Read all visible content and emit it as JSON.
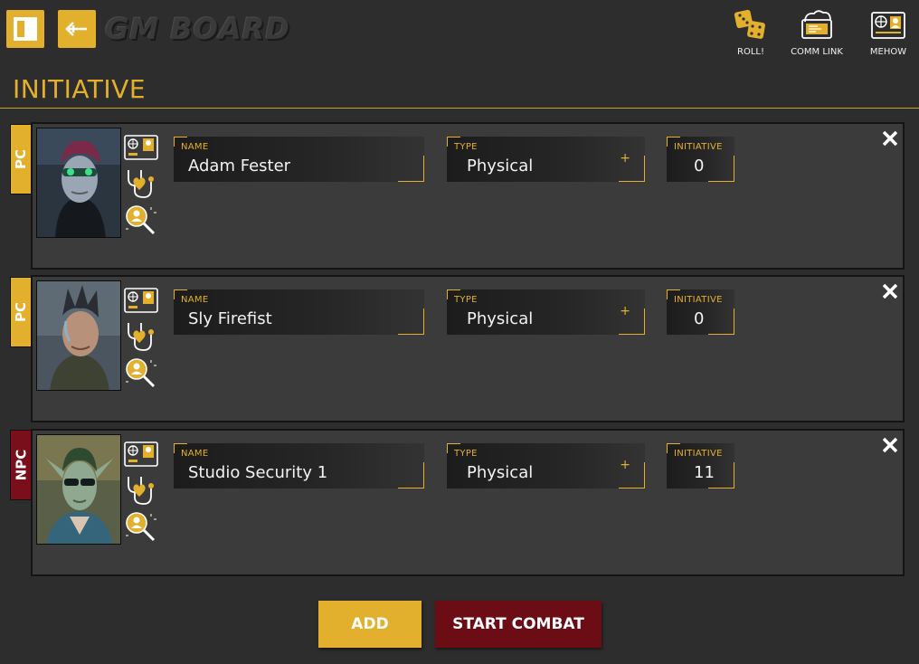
{
  "header": {
    "logo": "GM BOARD",
    "top_icons": [
      {
        "icon": "dice-icon",
        "label": "ROLL!"
      },
      {
        "icon": "comm-link-icon",
        "label": "COMM LINK"
      },
      {
        "icon": "id-card-icon",
        "label": "MEHOW"
      }
    ]
  },
  "section": {
    "title": "INITIATIVE"
  },
  "labels": {
    "name": "NAME",
    "type": "TYPE",
    "initiative": "INITIATIVE"
  },
  "combatants": [
    {
      "tag": "PC",
      "name": "Adam Fester",
      "type": "Physical",
      "initiative": "0",
      "portrait": "portrait-adam"
    },
    {
      "tag": "PC",
      "name": "Sly Firefist",
      "type": "Physical",
      "initiative": "0",
      "portrait": "portrait-sly"
    },
    {
      "tag": "NPC",
      "name": "Studio Security 1",
      "type": "Physical",
      "initiative": "11",
      "portrait": "portrait-elf"
    }
  ],
  "type_plus": "+",
  "buttons": {
    "add": "ADD",
    "start_combat": "START COMBAT"
  },
  "colors": {
    "accent": "#e3b02e",
    "npc": "#7a0f1c",
    "background": "#2d2d2d",
    "card": "#3b3b3b"
  }
}
